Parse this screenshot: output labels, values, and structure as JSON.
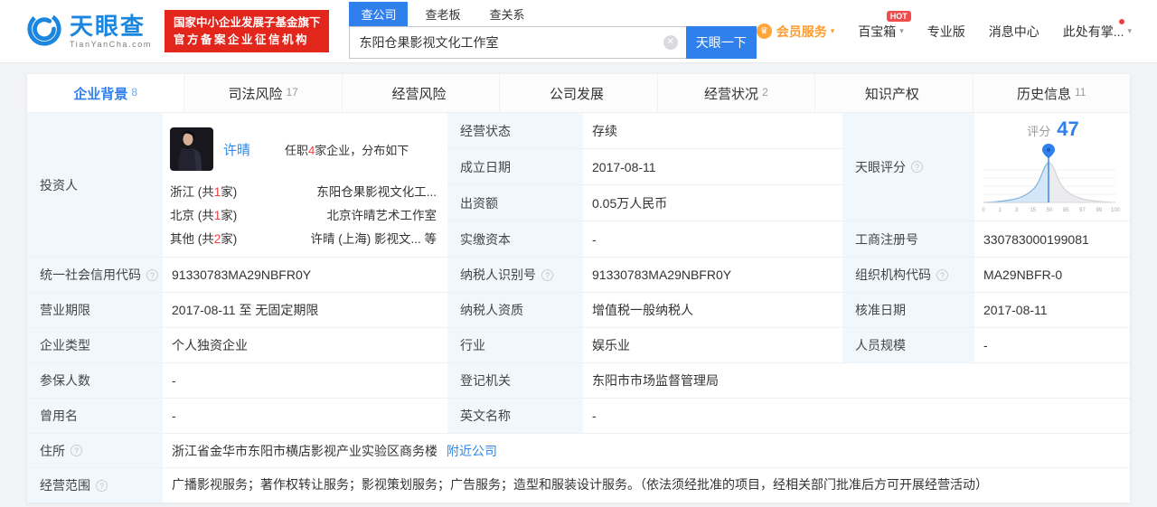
{
  "icons": {
    "help": "?",
    "clear": "✕",
    "caret": "▾",
    "crown": "♛"
  },
  "header": {
    "logo_title": "天眼查",
    "logo_domain": "TianYanCha.com",
    "badge_line1": "国家中小企业发展子基金旗下",
    "badge_line2": "官方备案企业征信机构",
    "search_tabs": [
      {
        "label": "查公司"
      },
      {
        "label": "查老板"
      },
      {
        "label": "查关系"
      }
    ],
    "search_value": "东阳仓果影视文化工作室",
    "search_button": "天眼一下",
    "nav_vip": "会员服务",
    "nav_toolbox": "百宝箱",
    "nav_toolbox_badge": "HOT",
    "nav_pro": "专业版",
    "nav_messages": "消息中心",
    "nav_more": "此处有掌..."
  },
  "tabs": [
    {
      "label": "企业背景",
      "count": "8"
    },
    {
      "label": "司法风险",
      "count": "17"
    },
    {
      "label": "经营风险",
      "count": ""
    },
    {
      "label": "公司发展",
      "count": ""
    },
    {
      "label": "经营状况",
      "count": "2"
    },
    {
      "label": "知识产权",
      "count": ""
    },
    {
      "label": "历史信息",
      "count": "11"
    }
  ],
  "investor": {
    "label": "投资人",
    "name": "许晴",
    "job_prefix": "任职",
    "job_count": "4",
    "job_suffix": "家企业，分布如下",
    "rows": [
      {
        "region_pre": "浙江 (共",
        "count": "1",
        "region_post": "家)",
        "company": "东阳仓果影视文化工..."
      },
      {
        "region_pre": "北京 (共",
        "count": "1",
        "region_post": "家)",
        "company": "北京许晴艺术工作室"
      },
      {
        "region_pre": "其他 (共",
        "count": "2",
        "region_post": "家)",
        "company": "许晴 (上海) 影视文... 等"
      }
    ]
  },
  "status_rows": [
    {
      "label": "经营状态",
      "value": "存续"
    },
    {
      "label": "成立日期",
      "value": "2017-08-11"
    },
    {
      "label": "出资额",
      "value": "0.05万人民币"
    },
    {
      "label": "实缴资本",
      "value": "-"
    }
  ],
  "score": {
    "label": "天眼评分",
    "title": "评分",
    "value": "47"
  },
  "chart_data": {
    "type": "area",
    "title": "评分 47",
    "marker_value": 47,
    "x_ticks": [
      "0",
      "1",
      "3",
      "15",
      "50",
      "85",
      "97",
      "99",
      "100"
    ],
    "note": "percentile bell curve, blue fill left of marker at 47, gray fill right, pin marker at peak"
  },
  "registration": {
    "label": "工商注册号",
    "value": "330783000199081"
  },
  "info_rows": [
    {
      "c1_label": "统一社会信用代码",
      "c1_value": "91330783MA29NBFR0Y",
      "c2_label": "纳税人识别号",
      "c2_value": "91330783MA29NBFR0Y",
      "c3_label": "组织机构代码",
      "c3_value": "MA29NBFR-0"
    },
    {
      "c1_label": "营业期限",
      "c1_value": "2017-08-11 至 无固定期限",
      "c2_label": "纳税人资质",
      "c2_value": "增值税一般纳税人",
      "c3_label": "核准日期",
      "c3_value": "2017-08-11"
    },
    {
      "c1_label": "企业类型",
      "c1_value": "个人独资企业",
      "c2_label": "行业",
      "c2_value": "娱乐业",
      "c3_label": "人员规模",
      "c3_value": "-"
    },
    {
      "c1_label": "参保人数",
      "c1_value": "-",
      "c2_label": "登记机关",
      "c2_value": "东阳市市场监督管理局"
    },
    {
      "c1_label": "曾用名",
      "c1_value": "-",
      "c2_label": "英文名称",
      "c2_value": "-"
    }
  ],
  "address": {
    "label": "住所",
    "value": "浙江省金华市东阳市横店影视产业实验区商务楼",
    "link": "附近公司"
  },
  "business_scope": {
    "label": "经营范围",
    "value": "广播影视服务；著作权转让服务；影视策划服务；广告服务；造型和服装设计服务。（依法须经批准的项目，经相关部门批准后方可开展经营活动）"
  }
}
